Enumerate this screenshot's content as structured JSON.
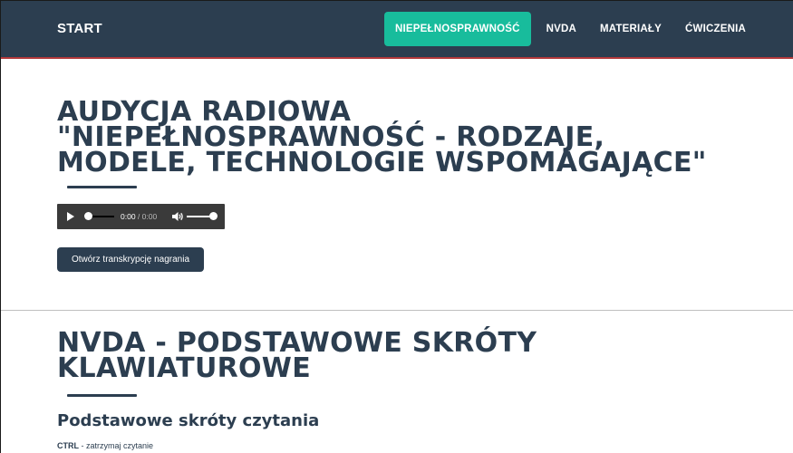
{
  "navbar": {
    "brand": "START",
    "items": [
      {
        "label": "NIEPEŁNOSPRAWNOŚĆ",
        "active": true
      },
      {
        "label": "NVDA",
        "active": false
      },
      {
        "label": "MATERIAŁY",
        "active": false
      },
      {
        "label": "ĆWICZENIA",
        "active": false
      }
    ]
  },
  "section1": {
    "title_lines": [
      "AUDYCJA RADIOWA",
      "\"NIEPEŁNOSPRAWNOŚĆ - RODZAJE,",
      "MODELE, TECHNOLOGIE WSPOMAGAJĄCE\""
    ],
    "audio": {
      "current_time": "0:00",
      "separator": " / ",
      "duration": "0:00"
    },
    "transcript_button": "Otwórz transkrypcję nagrania"
  },
  "section2": {
    "title_lines": [
      "NVDA - PODSTAWOWE SKRÓTY",
      "KLAWIATUROWE"
    ],
    "subtitle": "Podstawowe skróty czytania",
    "shortcuts": [
      {
        "key": "CTRL",
        "description": " - zatrzymaj czytanie"
      }
    ]
  },
  "colors": {
    "navbar_bg": "#2c3e50",
    "navbar_border": "#b3393b",
    "accent": "#18bc9c",
    "heading": "#2c3e50",
    "audio_bg": "#3a3a3a"
  }
}
